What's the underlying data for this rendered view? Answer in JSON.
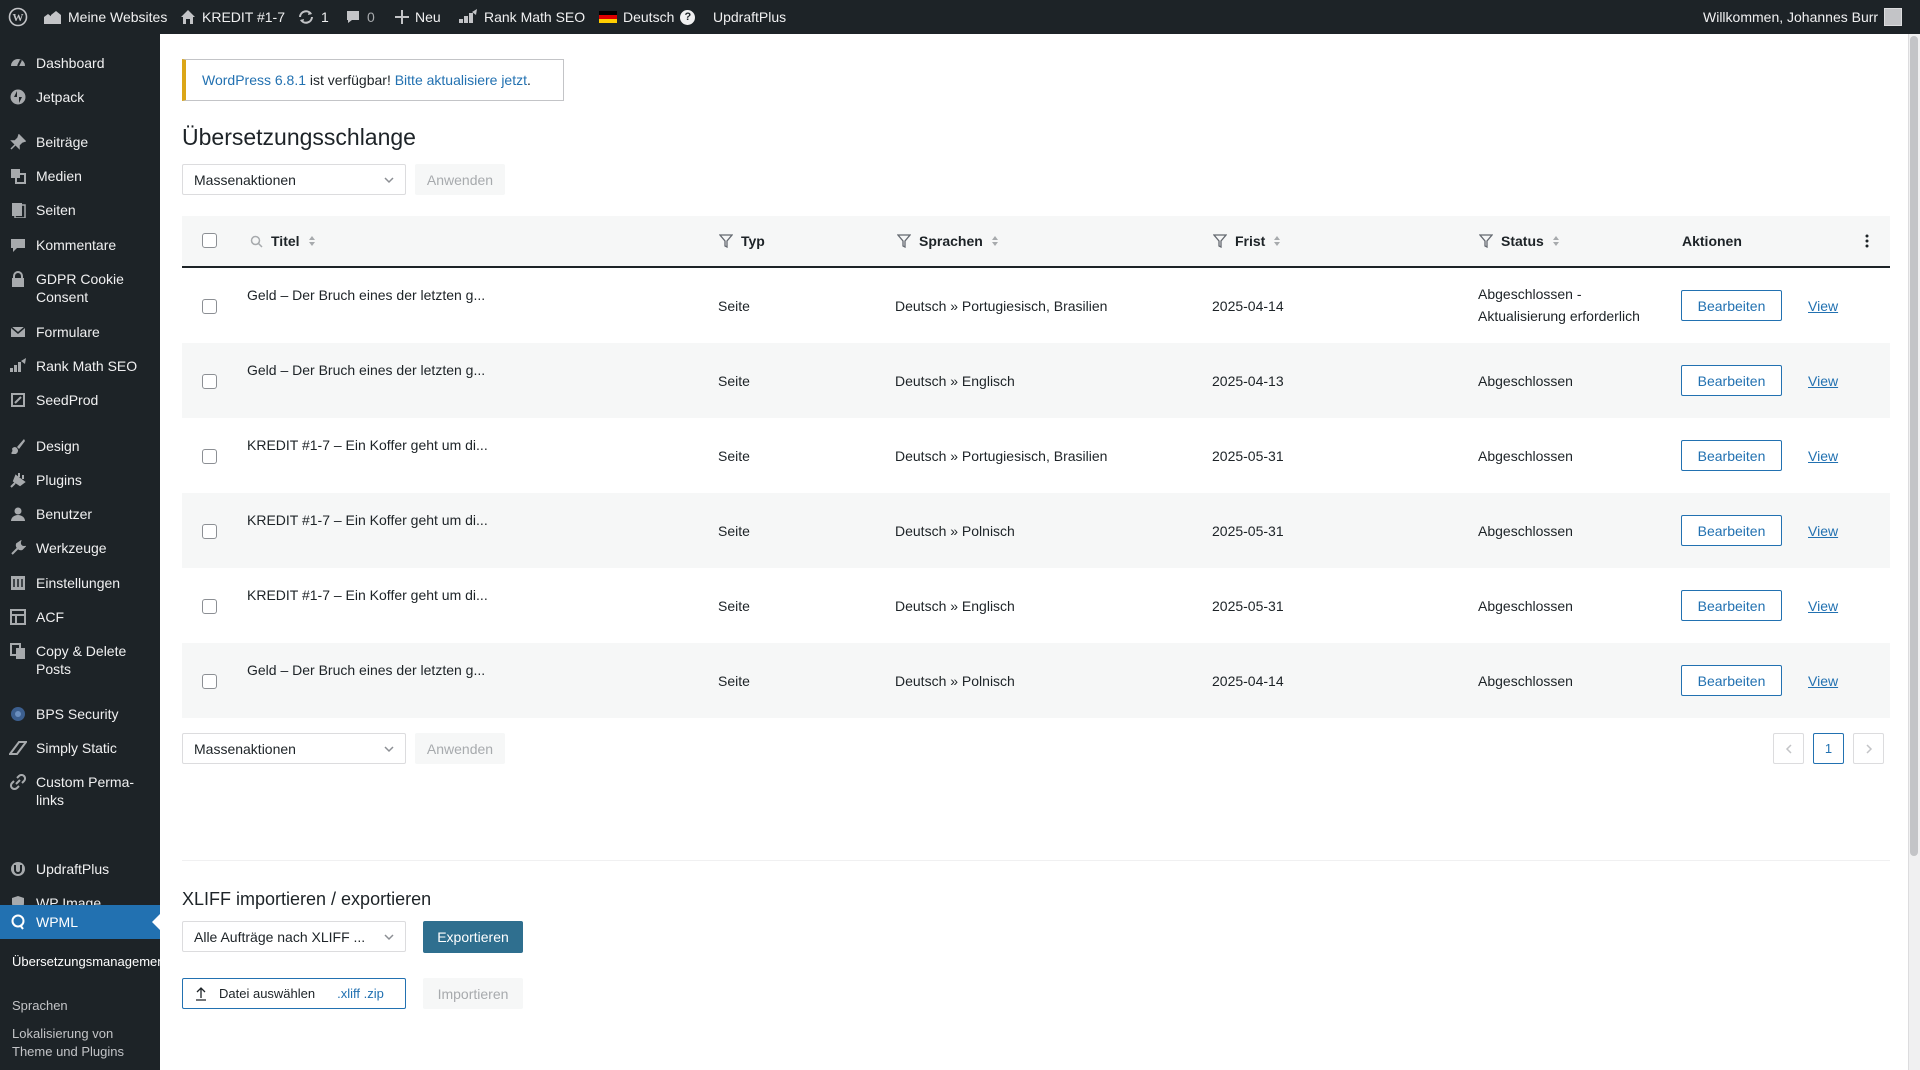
{
  "adminbar": {
    "my_sites": "Meine Websites",
    "site": "KREDIT #1-7",
    "updates_count": "1",
    "comments_count": "0",
    "new": "Neu",
    "rank_math": "Rank Math SEO",
    "language": "Deutsch",
    "updraft": "UpdraftPlus",
    "greeting": "Willkommen, Johannes Burr"
  },
  "sidebar": {
    "items": [
      {
        "label": "Dashboard",
        "icon": "dashboard-icon"
      },
      {
        "label": "Jetpack",
        "icon": "jetpack-icon"
      },
      {
        "label": "Beiträge",
        "icon": "pin-icon"
      },
      {
        "label": "Medien",
        "icon": "media-icon"
      },
      {
        "label": "Seiten",
        "icon": "pages-icon"
      },
      {
        "label": "Kommentare",
        "icon": "comments-icon"
      },
      {
        "label": "GDPR Cookie Consent",
        "icon": "lock-icon"
      },
      {
        "label": "Formulare",
        "icon": "mail-icon"
      },
      {
        "label": "Rank Math SEO",
        "icon": "chart-icon"
      },
      {
        "label": "SeedProd",
        "icon": "seedprod-icon"
      },
      {
        "label": "Design",
        "icon": "brush-icon"
      },
      {
        "label": "Plugins",
        "icon": "plugin-icon"
      },
      {
        "label": "Benutzer",
        "icon": "user-icon"
      },
      {
        "label": "Werkzeuge",
        "icon": "wrench-icon"
      },
      {
        "label": "Einstellungen",
        "icon": "settings-icon"
      },
      {
        "label": "ACF",
        "icon": "grid-icon"
      },
      {
        "label": "Copy & Delete Posts",
        "icon": "copy-icon"
      },
      {
        "label": "BPS Security",
        "icon": "shield-icon"
      },
      {
        "label": "Simply Static",
        "icon": "bolt-icon"
      },
      {
        "label": "Custom Perma-links",
        "icon": "link-icon"
      },
      {
        "label": "UpdraftPlus",
        "icon": "updraft-icon"
      },
      {
        "label": "WP Image CAPTCHA",
        "icon": "shield-icon"
      },
      {
        "label": "WPML",
        "icon": "wpml-icon"
      }
    ],
    "submenu": [
      "Übersetzungsmanagement",
      "Sprachen",
      "Lokalisierung von Theme und Plugins"
    ]
  },
  "notice": {
    "version_link": "WordPress 6.8.1",
    "text": " ist verfügbar! ",
    "update_link": "Bitte aktualisiere jetzt",
    "end": "."
  },
  "page_title": "Übersetzungsschlange",
  "bulk": {
    "select": "Massenaktionen",
    "apply": "Anwenden"
  },
  "table": {
    "columns": {
      "title": "Titel",
      "type": "Typ",
      "languages": "Sprachen",
      "deadline": "Frist",
      "status": "Status",
      "actions": "Aktionen"
    },
    "rows": [
      {
        "title": "Geld – Der Bruch eines der letzten g...",
        "type": "Seite",
        "languages": "Deutsch » Portugiesisch, Brasilien",
        "deadline": "2025-04-14",
        "status": "Abgeschlossen -",
        "status2": "Aktualisierung erforderlich",
        "edit": "Bearbeiten",
        "view": "View"
      },
      {
        "title": "Geld – Der Bruch eines der letzten g...",
        "type": "Seite",
        "languages": "Deutsch » Englisch",
        "deadline": "2025-04-13",
        "status": "Abgeschlossen",
        "status2": "",
        "edit": "Bearbeiten",
        "view": "View"
      },
      {
        "title": "KREDIT #1-7 – Ein Koffer geht um di...",
        "type": "Seite",
        "languages": "Deutsch » Portugiesisch, Brasilien",
        "deadline": "2025-05-31",
        "status": "Abgeschlossen",
        "status2": "",
        "edit": "Bearbeiten",
        "view": "View"
      },
      {
        "title": "KREDIT #1-7 – Ein Koffer geht um di...",
        "type": "Seite",
        "languages": "Deutsch » Polnisch",
        "deadline": "2025-05-31",
        "status": "Abgeschlossen",
        "status2": "",
        "edit": "Bearbeiten",
        "view": "View"
      },
      {
        "title": "KREDIT #1-7 – Ein Koffer geht um di...",
        "type": "Seite",
        "languages": "Deutsch » Englisch",
        "deadline": "2025-05-31",
        "status": "Abgeschlossen",
        "status2": "",
        "edit": "Bearbeiten",
        "view": "View"
      },
      {
        "title": "Geld – Der Bruch eines der letzten g...",
        "type": "Seite",
        "languages": "Deutsch » Polnisch",
        "deadline": "2025-04-14",
        "status": "Abgeschlossen",
        "status2": "",
        "edit": "Bearbeiten",
        "view": "View"
      }
    ]
  },
  "pagination": {
    "current": "1"
  },
  "xliff": {
    "title": "XLIFF importieren / exportieren",
    "select": "Alle Aufträge nach XLIFF ...",
    "export": "Exportieren",
    "choose_file": "Datei auswählen",
    "extensions": ".xliff .zip",
    "import": "Importieren"
  },
  "colors": {
    "adminbar": "#1d2327",
    "accent": "#2271b1",
    "notice": "#dba617",
    "export_button": "#2f6f8f"
  }
}
